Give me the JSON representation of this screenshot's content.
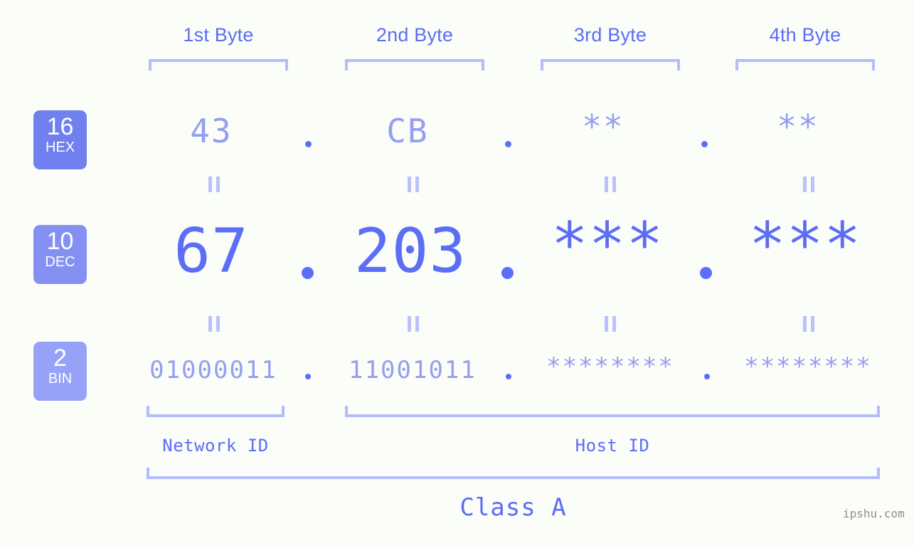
{
  "background_color": "#fbfdf9",
  "accent_color": "#5b6ef5",
  "muted_accent_color": "#949fef",
  "bracket_color": "#b3bdfb",
  "header": {
    "bytes": [
      {
        "label": "1st Byte"
      },
      {
        "label": "2nd Byte"
      },
      {
        "label": "3rd Byte"
      },
      {
        "label": "4th Byte"
      }
    ]
  },
  "bases": [
    {
      "number": "16",
      "abbr": "HEX",
      "color": "#7080ee"
    },
    {
      "number": "10",
      "abbr": "DEC",
      "color": "#8491f2"
    },
    {
      "number": "2",
      "abbr": "BIN",
      "color": "#95a2f8"
    }
  ],
  "rows": {
    "hex": {
      "values": [
        "43",
        "CB",
        "**",
        "**"
      ],
      "separators": [
        ".",
        ".",
        "."
      ]
    },
    "dec": {
      "values": [
        "67",
        "203",
        "***",
        "***"
      ],
      "separators": [
        ".",
        ".",
        "."
      ]
    },
    "bin": {
      "values": [
        "01000011",
        "11001011",
        "********",
        "********"
      ],
      "separators": [
        ".",
        ".",
        "."
      ]
    }
  },
  "equality_marks": {
    "symbol": "=",
    "count_per_row": 4
  },
  "sections": [
    {
      "label": "Network ID"
    },
    {
      "label": "Host ID"
    }
  ],
  "class": {
    "label": "Class A"
  },
  "watermark": {
    "text": "ipshu.com"
  }
}
